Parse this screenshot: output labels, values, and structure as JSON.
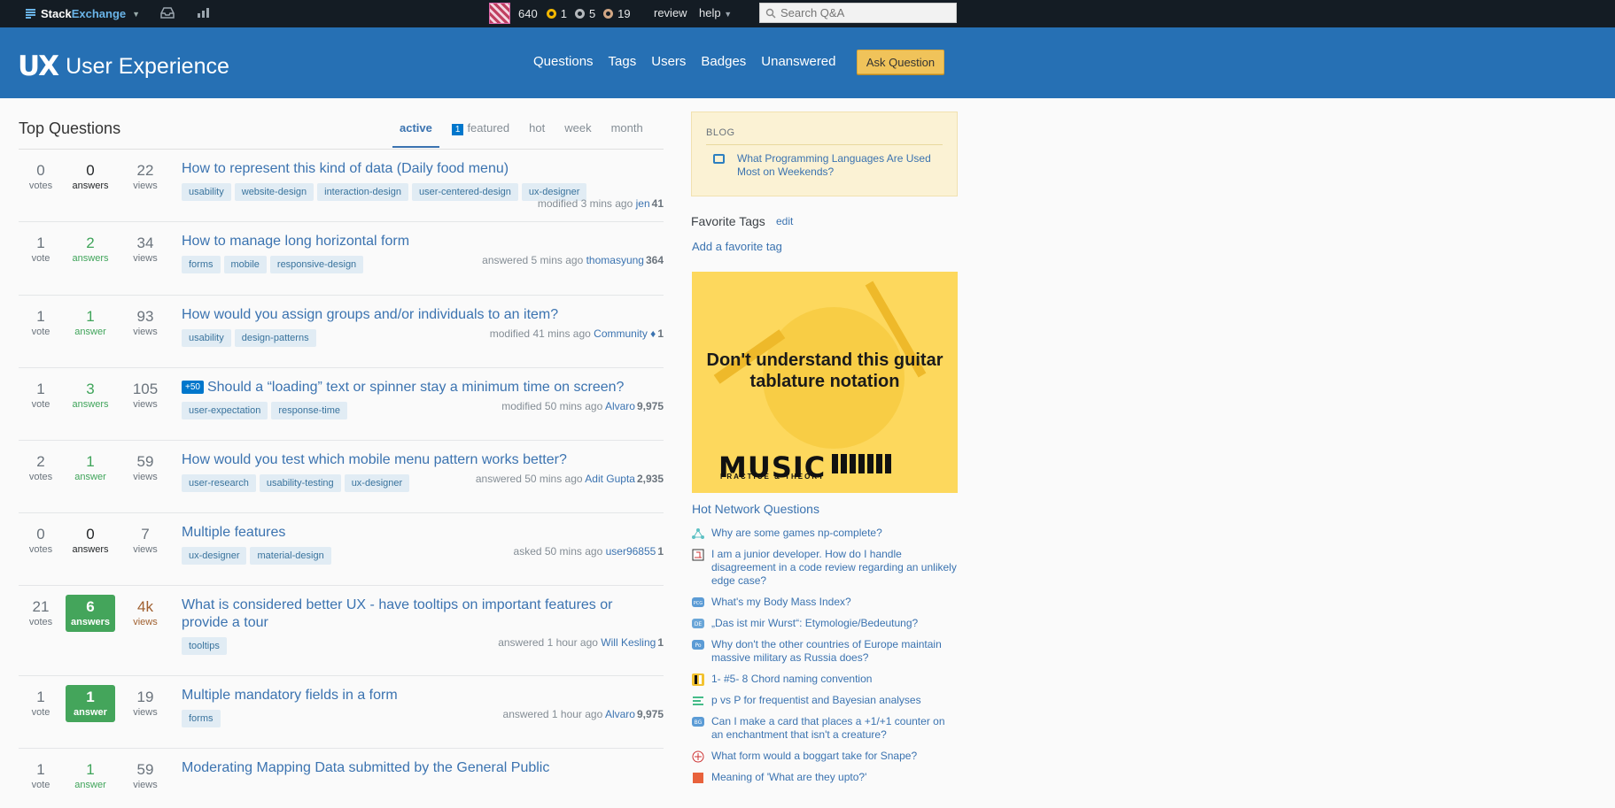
{
  "topbar": {
    "brand_a": "Stack",
    "brand_b": "Exchange",
    "reputation": "640",
    "gold": "1",
    "silver": "5",
    "bronze": "19",
    "review": "review",
    "help": "help",
    "search_placeholder": "Search Q&A"
  },
  "header": {
    "logo_mark": "UX",
    "site_name": "User Experience",
    "nav": [
      "Questions",
      "Tags",
      "Users",
      "Badges",
      "Unanswered"
    ],
    "ask": "Ask Question"
  },
  "main": {
    "title": "Top Questions",
    "tabs": {
      "active": "active",
      "featured_count": "1",
      "featured": "featured",
      "hot": "hot",
      "week": "week",
      "month": "month"
    },
    "questions": [
      {
        "votes": "0",
        "votes_label": "votes",
        "answers": "0",
        "answers_label": "answers",
        "views": "22",
        "views_label": "views",
        "title": "How to represent this kind of data (Daily food menu)",
        "tags": [
          "usability",
          "website-design",
          "interaction-design",
          "user-centered-design",
          "ux-designer"
        ],
        "meta": "modified 3 mins ago",
        "user": "jen",
        "rep": "41"
      },
      {
        "votes": "1",
        "votes_label": "vote",
        "answers": "2",
        "answers_label": "answers",
        "views": "34",
        "views_label": "views",
        "title": "How to manage long horizontal form",
        "tags": [
          "forms",
          "mobile",
          "responsive-design"
        ],
        "meta": "answered 5 mins ago",
        "user": "thomasyung",
        "rep": "364"
      },
      {
        "votes": "1",
        "votes_label": "vote",
        "answers": "1",
        "answers_label": "answer",
        "views": "93",
        "views_label": "views",
        "title": "How would you assign groups and/or individuals to an item?",
        "tags": [
          "usability",
          "design-patterns"
        ],
        "meta": "modified 41 mins ago",
        "user": "Community ♦",
        "rep": "1"
      },
      {
        "votes": "1",
        "votes_label": "vote",
        "answers": "3",
        "answers_label": "answers",
        "views": "105",
        "views_label": "views",
        "bounty": "+50",
        "title": "Should a “loading” text or spinner stay a minimum time on screen?",
        "tags": [
          "user-expectation",
          "response-time"
        ],
        "meta": "modified 50 mins ago",
        "user": "Alvaro",
        "rep": "9,975"
      },
      {
        "votes": "2",
        "votes_label": "votes",
        "answers": "1",
        "answers_label": "answer",
        "views": "59",
        "views_label": "views",
        "title": "How would you test which mobile menu pattern works better?",
        "tags": [
          "user-research",
          "usability-testing",
          "ux-designer"
        ],
        "meta": "answered 50 mins ago",
        "user": "Adit Gupta",
        "rep": "2,935"
      },
      {
        "votes": "0",
        "votes_label": "votes",
        "answers": "0",
        "answers_label": "answers",
        "views": "7",
        "views_label": "views",
        "title": "Multiple features",
        "tags": [
          "ux-designer",
          "material-design"
        ],
        "meta": "asked 50 mins ago",
        "user": "user96855",
        "rep": "1"
      },
      {
        "votes": "21",
        "votes_label": "votes",
        "answers": "6",
        "answers_label": "answers",
        "views": "4k",
        "views_label": "views",
        "title": "What is considered better UX - have tooltips on important features or provide a tour",
        "tags": [
          "tooltips"
        ],
        "meta": "answered 1 hour ago",
        "user": "Will Kesling",
        "rep": "1"
      },
      {
        "votes": "1",
        "votes_label": "vote",
        "answers": "1",
        "answers_label": "answer",
        "views": "19",
        "views_label": "views",
        "title": "Multiple mandatory fields in a form",
        "tags": [
          "forms"
        ],
        "meta": "answered 1 hour ago",
        "user": "Alvaro",
        "rep": "9,975"
      },
      {
        "votes": "1",
        "votes_label": "vote",
        "answers": "1",
        "answers_label": "answer",
        "views": "59",
        "views_label": "views",
        "title": "Moderating Mapping Data submitted by the General Public",
        "tags": [],
        "meta": "",
        "user": "",
        "rep": ""
      }
    ]
  },
  "sidebar": {
    "blog_heading": "BLOG",
    "blog_link": "What Programming Languages Are Used Most on Weekends?",
    "fav_heading": "Favorite Tags",
    "fav_edit": "edit",
    "fav_add": "Add a favorite tag",
    "ad_text": "Don't understand this guitar tablature notation",
    "ad_logo": "MUSIC",
    "ad_sub": "PRACTICE & THEORY",
    "hnq_heading": "Hot Network Questions",
    "hnq": [
      {
        "title": "Why are some games np-complete?",
        "icon": "cs-icon",
        "color": "#5ec1c4"
      },
      {
        "title": "I am a junior developer. How do I handle disagreement in a code review regarding an unlikely edge case?",
        "icon": "workplace-icon",
        "color": "#ffffff"
      },
      {
        "title": "What's my Body Mass Index?",
        "icon": "codegolf-icon",
        "color": "#5b9bd5"
      },
      {
        "title": "„Das ist mir Wurst“: Etymologie/Bedeutung?",
        "icon": "german-icon",
        "color": "#6aa6d8"
      },
      {
        "title": "Why don't the other countries of Europe maintain massive military as Russia does?",
        "icon": "politics-icon",
        "color": "#5b9bd5"
      },
      {
        "title": "1- #5- 8 Chord naming convention",
        "icon": "music-icon",
        "color": "#f2c230"
      },
      {
        "title": "p vs P for frequentist and Bayesian analyses",
        "icon": "stats-icon",
        "color": "#ffffff"
      },
      {
        "title": "Can I make a card that places a +1/+1 counter on an enchantment that isn't a creature?",
        "icon": "boardgames-icon",
        "color": "#5b9bd5"
      },
      {
        "title": "What form would a boggart take for Snape?",
        "icon": "scifi-icon",
        "color": "#ffffff"
      },
      {
        "title": "Meaning of 'What are they upto?'",
        "icon": "ell-icon",
        "color": "#e8623c"
      }
    ]
  }
}
